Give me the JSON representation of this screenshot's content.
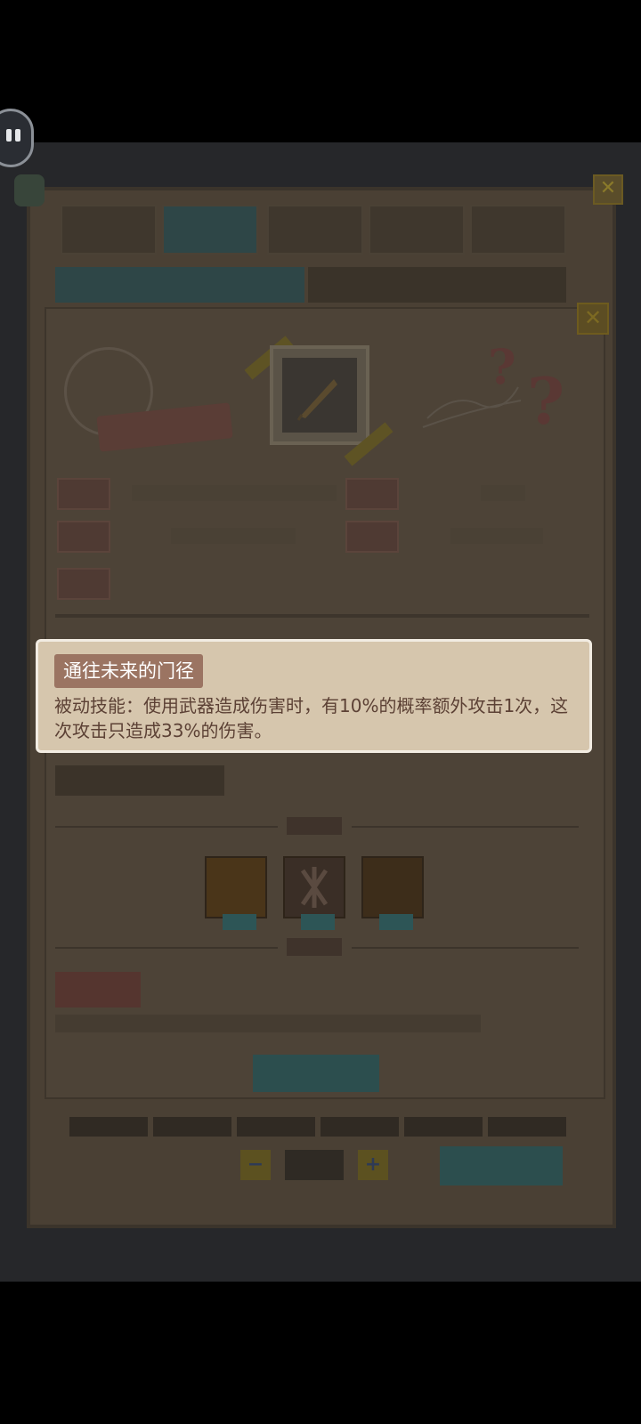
{
  "tooltip": {
    "title": "通往未来的门径",
    "text": "被动技能：使用武器造成伤害时，有10%的概率额外攻击1次，这次攻击只造成33%的伤害。"
  },
  "background_icons": {
    "back_button": "pause-icon",
    "outer_close": "close-icon",
    "card_close": "close-icon",
    "item": "feather-quill-icon",
    "minus": "minus-icon",
    "plus": "plus-icon"
  },
  "colors": {
    "tooltip_bg": "#d6c6ad",
    "tooltip_border": "#f2ece2",
    "title_bg": "#9b7462",
    "text_color": "#5c4135",
    "overlay": "#26272a"
  }
}
